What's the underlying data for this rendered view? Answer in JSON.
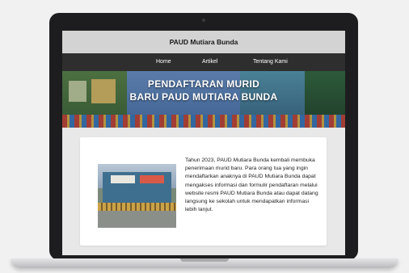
{
  "site": {
    "title": "PAUD Mutiara Bunda"
  },
  "nav": {
    "items": [
      {
        "label": "Home"
      },
      {
        "label": "Artikel"
      },
      {
        "label": "Tentang Kami"
      }
    ]
  },
  "hero": {
    "title_line1": "PENDAFTARAN MURID",
    "title_line2": "BARU PAUD MUTIARA BUNDA"
  },
  "article": {
    "body": "Tahun 2023, PAUD Mutiara Bunda kembali membuka penerimaan murid baru. Para orang tua yang ingin mendaftarkan anaknya di PAUD Mutiara Bunda dapat mengakses informasi dan formulir pendaftaran melalui website resmi PAUD Mutiara Bunda atau dapat datang langsung ke sekolah untuk mendapatkan informasi lebih lanjut."
  },
  "colors": {
    "titlebar": "#d3d3d3",
    "navbar": "#2e2e2e",
    "laptop_frame": "#1d1d1f",
    "card": "#ffffff"
  }
}
